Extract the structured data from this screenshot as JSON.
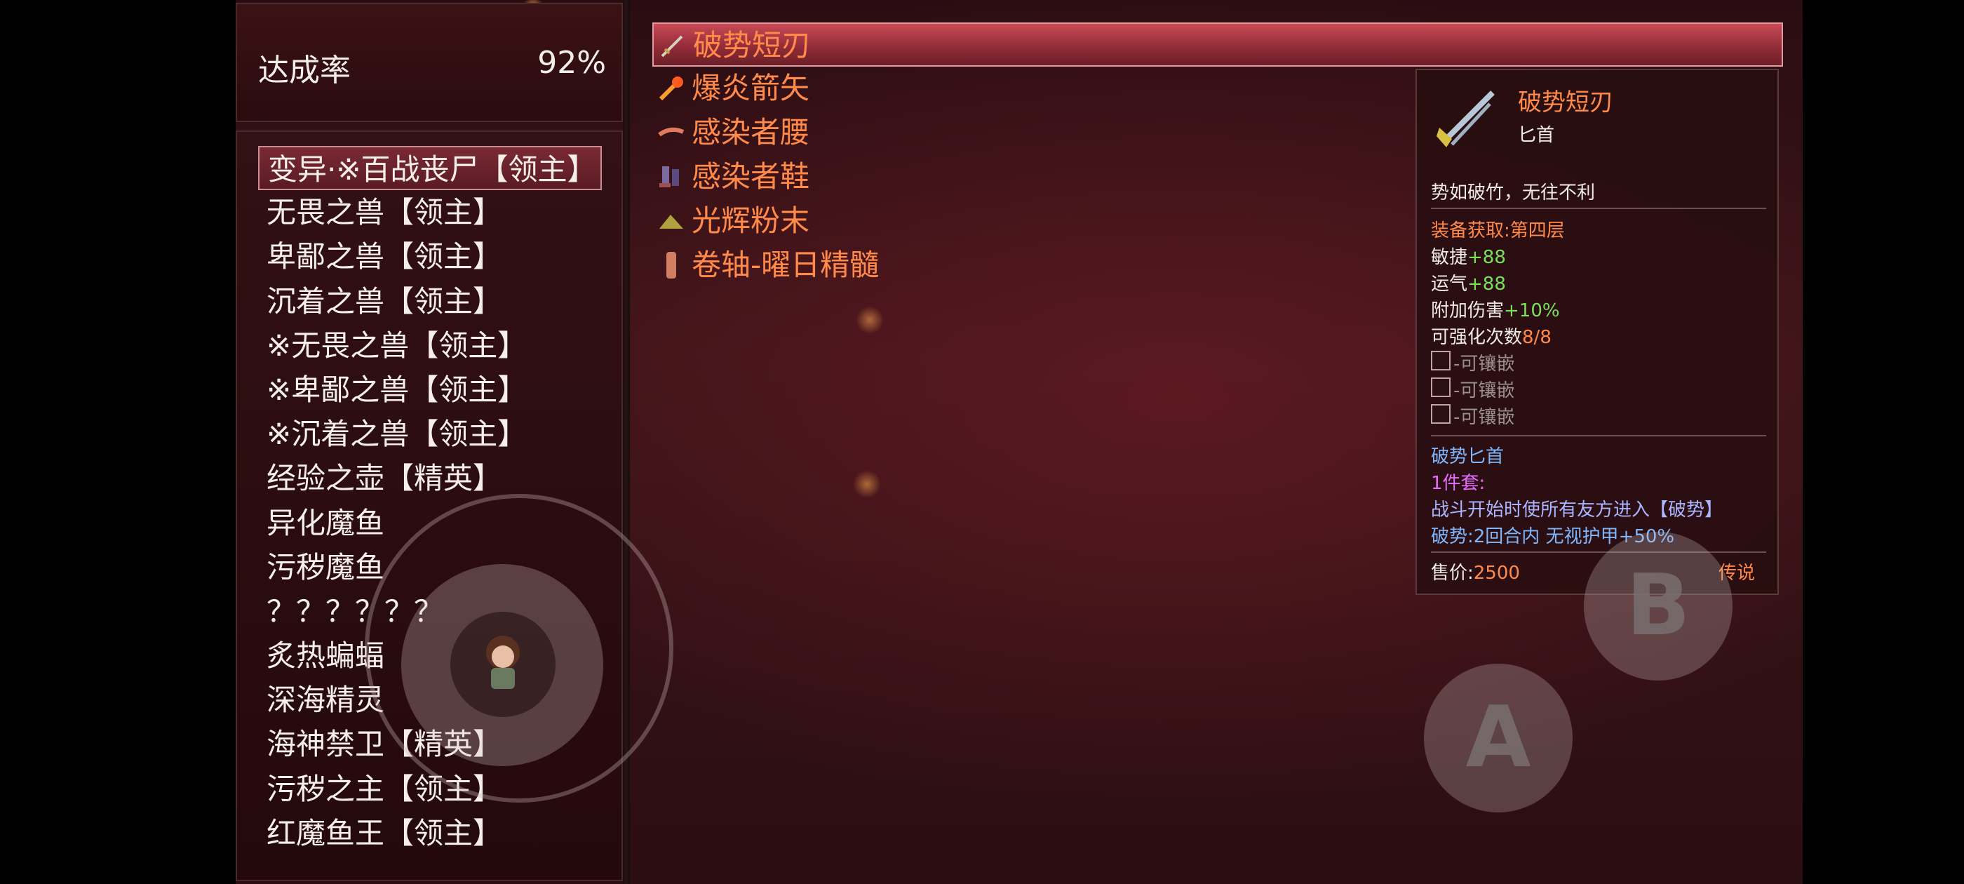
{
  "completion": {
    "label": "达成率",
    "value": "92%"
  },
  "monsters": [
    "变异·※百战丧尸【领主】",
    "无畏之兽【领主】",
    "卑鄙之兽【领主】",
    "沉着之兽【领主】",
    "※无畏之兽【领主】",
    "※卑鄙之兽【领主】",
    "※沉着之兽【领主】",
    "经验之壶【精英】",
    "异化魔鱼",
    "污秽魔鱼",
    "？？？？？？",
    "炙热蝙蝠",
    "深海精灵",
    "海神禁卫【精英】",
    "污秽之主【领主】",
    "红魔鱼王【领主】"
  ],
  "items": [
    {
      "name": "破势短刃",
      "icon": "dagger-icon"
    },
    {
      "name": "爆炎箭矢",
      "icon": "fire-arrow-icon"
    },
    {
      "name": "感染者腰",
      "icon": "belt-icon"
    },
    {
      "name": "感染者鞋",
      "icon": "boots-icon"
    },
    {
      "name": "光辉粉末",
      "icon": "powder-icon"
    },
    {
      "name": "卷轴-曜日精髓",
      "icon": "scroll-icon"
    }
  ],
  "detail": {
    "name": "破势短刃",
    "type": "匕首",
    "flavor": "势如破竹，无往不利",
    "source": "装备获取:第四层",
    "stats": [
      {
        "label": "敏捷",
        "value": "+88"
      },
      {
        "label": "运气",
        "value": "+88"
      },
      {
        "label": "附加伤害",
        "value": "+10%"
      }
    ],
    "enhance_label": "可强化次数",
    "enhance_value": "8/8",
    "sockets": [
      "-可镶嵌",
      "-可镶嵌",
      "-可镶嵌"
    ],
    "set_name": "破势匕首",
    "set_count": "1件套:",
    "set_effect": "战斗开始时使所有友方进入【破势】",
    "set_detail": "破势:2回合内 无视护甲+50%",
    "price_label": "售价:",
    "price_value": "2500",
    "rarity": "传说"
  },
  "buttons": {
    "a": "A",
    "b": "B"
  },
  "colors": {
    "item_text": "#ff8a4a",
    "stat_green": "#7be05a",
    "set_pink": "#e46cff",
    "selected_bar": "#c94a55"
  }
}
